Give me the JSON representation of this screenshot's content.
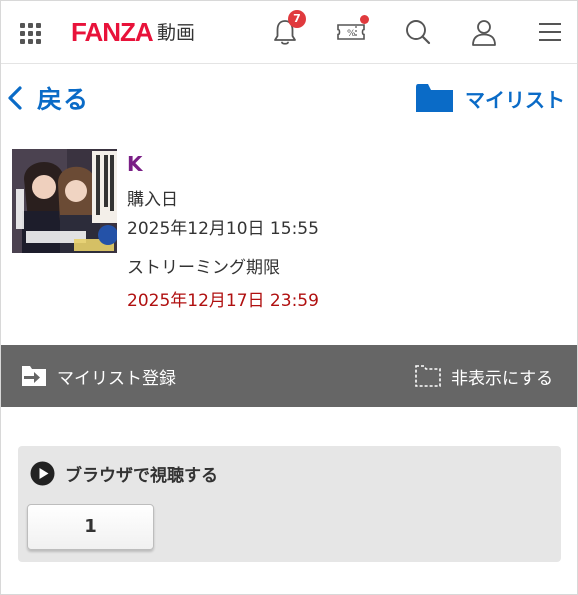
{
  "header": {
    "logo_text": "FANZA",
    "logo_sub": "動画",
    "notification_count": "7",
    "icons": [
      "grid-menu-icon",
      "bell-icon",
      "coupon-icon",
      "search-icon",
      "user-icon",
      "hamburger-menu-icon"
    ]
  },
  "nav": {
    "back_label": "戻る",
    "mylist_label": "マイリスト"
  },
  "item": {
    "title": "K",
    "purchase_label": "購入日",
    "purchase_date": "2025年12月10日 15:55",
    "streaming_label": "ストリーミング期限",
    "streaming_deadline": "2025年12月17日 23:59"
  },
  "actions": {
    "mylist_register": "マイリスト登録",
    "hide": "非表示にする"
  },
  "browser": {
    "heading": "ブラウザで視聴する",
    "part_button": "1"
  },
  "colors": {
    "brand": "#e8123a",
    "link": "#0a6bc7",
    "title": "#7a1f86",
    "deadline": "#b01010",
    "action_bar": "#666666"
  }
}
